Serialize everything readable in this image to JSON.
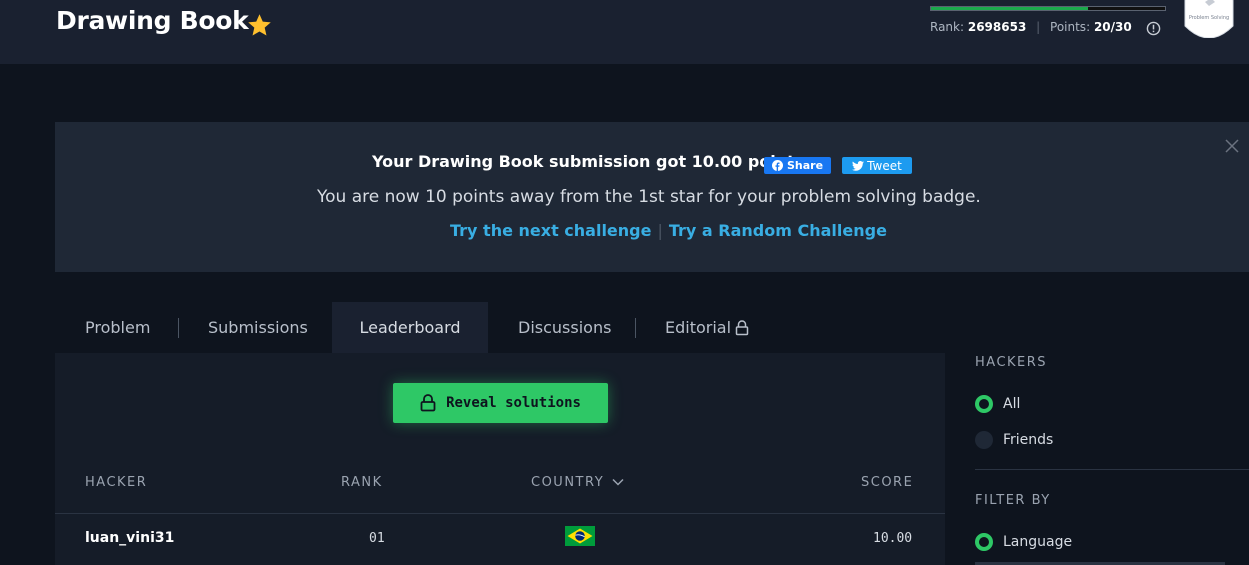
{
  "header": {
    "title": "Drawing Book",
    "progress_fraction": 0.67,
    "rank_label": "Rank:",
    "rank_value": "2698653",
    "points_label": "Points:",
    "points_value": "20/30",
    "badge_label": "Problem Solving"
  },
  "banner": {
    "message": "Your Drawing Book submission got 10.00 points.",
    "share_label": "Share",
    "tweet_label": "Tweet",
    "progress_message": "You are now 10 points away from the 1st star for your problem solving badge.",
    "next_link": "Try the next challenge",
    "random_link": "Try a Random Challenge"
  },
  "tabs": [
    {
      "label": "Problem"
    },
    {
      "label": "Submissions"
    },
    {
      "label": "Leaderboard"
    },
    {
      "label": "Discussions"
    },
    {
      "label": "Editorial"
    }
  ],
  "reveal_button": "Reveal solutions",
  "table": {
    "headers": [
      "HACKER",
      "RANK",
      "COUNTRY",
      "SCORE"
    ],
    "rows": [
      {
        "hacker": "luan_vini31",
        "rank": "01",
        "country": "Brazil",
        "score": "10.00"
      }
    ]
  },
  "sidebar": {
    "hackers_heading": "HACKERS",
    "options": [
      {
        "label": "All",
        "selected": true
      },
      {
        "label": "Friends",
        "selected": false
      }
    ],
    "filter_heading": "FILTER BY",
    "filter_options": [
      {
        "label": "Language",
        "selected": true
      }
    ]
  },
  "colors": {
    "background": "#0e141e",
    "accent_green": "#2ec866",
    "link_blue": "#39aee3",
    "star_gold": "#ffc02e"
  }
}
